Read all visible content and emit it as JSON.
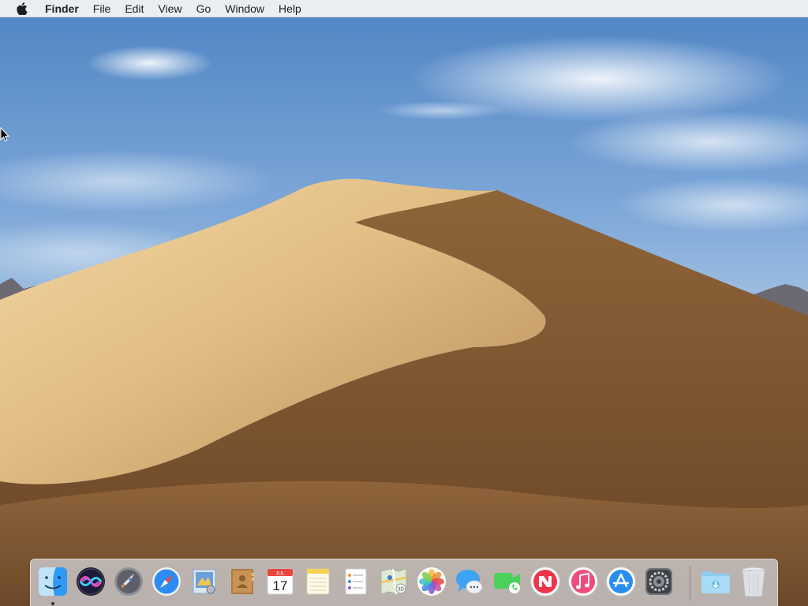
{
  "menubar": {
    "apple_icon": "apple-logo-icon",
    "app_name": "Finder",
    "items": [
      "File",
      "Edit",
      "View",
      "Go",
      "Window",
      "Help"
    ]
  },
  "dock": {
    "apps": [
      {
        "name": "Finder",
        "icon": "finder-icon",
        "running": true
      },
      {
        "name": "Siri",
        "icon": "siri-icon"
      },
      {
        "name": "Launchpad",
        "icon": "launchpad-icon"
      },
      {
        "name": "Safari",
        "icon": "safari-icon"
      },
      {
        "name": "Mail",
        "icon": "mail-icon"
      },
      {
        "name": "Contacts",
        "icon": "contacts-icon"
      },
      {
        "name": "Calendar",
        "icon": "calendar-icon",
        "month": "JUL",
        "day": "17"
      },
      {
        "name": "Notes",
        "icon": "notes-icon"
      },
      {
        "name": "Reminders",
        "icon": "reminders-icon"
      },
      {
        "name": "Maps",
        "icon": "maps-icon"
      },
      {
        "name": "Photos",
        "icon": "photos-icon"
      },
      {
        "name": "Messages",
        "icon": "messages-icon"
      },
      {
        "name": "FaceTime",
        "icon": "facetime-icon"
      },
      {
        "name": "News",
        "icon": "news-icon"
      },
      {
        "name": "iTunes",
        "icon": "itunes-icon"
      },
      {
        "name": "App Store",
        "icon": "app-store-icon"
      },
      {
        "name": "System Preferences",
        "icon": "system-preferences-icon"
      }
    ],
    "stack": {
      "name": "Downloads",
      "icon": "downloads-folder-icon"
    },
    "trash": {
      "name": "Trash",
      "icon": "trash-icon"
    }
  },
  "colors": {
    "sky": "#6f9bd0",
    "sand_light": "#e7c38a",
    "sand_dark": "#7a5532",
    "dock_bg": "#d7dae0",
    "menubar_bg": "#f6f6f6"
  }
}
